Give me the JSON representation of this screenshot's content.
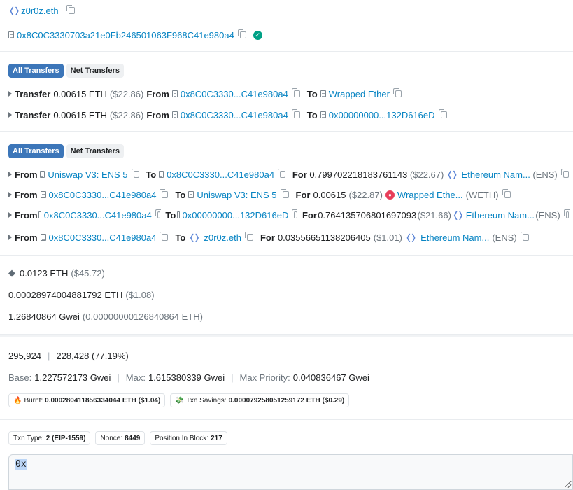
{
  "header": {
    "ens_name": "z0r0z.eth",
    "address": "0x8C0C3330703a21e0Fb246501063F968C41e980a4"
  },
  "tabs1": {
    "all": "All Transfers",
    "net": "Net Transfers"
  },
  "transfers": [
    {
      "kw": "Transfer",
      "amount": "0.00615 ETH",
      "usd": "($22.86)",
      "from_kw": "From",
      "from": "0x8C0C3330...C41e980a4",
      "to_kw": "To",
      "to": "Wrapped Ether"
    },
    {
      "kw": "Transfer",
      "amount": "0.00615 ETH",
      "usd": "($22.86)",
      "from_kw": "From",
      "from": "0x8C0C3330...C41e980a4",
      "to_kw": "To",
      "to": "0x00000000...132D616eD"
    }
  ],
  "tabs2": {
    "all": "All Transfers",
    "net": "Net Transfers"
  },
  "token_transfers": [
    {
      "from_kw": "From",
      "from": "Uniswap V3: ENS 5",
      "to_kw": "To",
      "to": "0x8C0C3330...C41e980a4",
      "for_kw": "For",
      "amount": "0.799702218183761143",
      "usd": "($22.67)",
      "token": "Ethereum Nam...",
      "symbol": "(ENS)"
    },
    {
      "from_kw": "From",
      "from": "0x8C0C3330...C41e980a4",
      "to_kw": "To",
      "to": "Uniswap V3: ENS 5",
      "for_kw": "For",
      "amount": "0.00615",
      "usd": "($22.87)",
      "token": "Wrapped Ethe...",
      "symbol": "(WETH)"
    },
    {
      "from_kw": "From",
      "from": "0x8C0C3330...C41e980a4",
      "to_kw": "To",
      "to": "0x00000000...132D616eD",
      "for_kw": "For",
      "amount": "0.764135706801697093",
      "usd": "($21.66)",
      "token": "Ethereum Nam...",
      "symbol": "(ENS)"
    },
    {
      "from_kw": "From",
      "from": "0x8C0C3330...C41e980a4",
      "to_kw": "To",
      "to": "z0r0z.eth",
      "for_kw": "For",
      "amount": "0.03556651138206405",
      "usd": "($1.01)",
      "token": "Ethereum Nam...",
      "symbol": "(ENS)"
    }
  ],
  "value": {
    "eth": "0.0123 ETH",
    "usd": "($45.72)"
  },
  "fee": {
    "eth": "0.00028974004881792 ETH",
    "usd": "($1.08)"
  },
  "gas_price": {
    "gwei": "1.26840864 Gwei",
    "eth": "(0.00000000126840864 ETH)"
  },
  "gas": {
    "limit": "295,924",
    "used": "228,428 (77.19%)"
  },
  "fees": {
    "base_label": "Base:",
    "base": "1.227572173 Gwei",
    "max_label": "Max:",
    "max": "1.615380339 Gwei",
    "priority_label": "Max Priority:",
    "priority": "0.040836467 Gwei"
  },
  "burnt": {
    "label": "Burnt:",
    "value": "0.000280411856334044 ETH ($1.04)"
  },
  "savings": {
    "label": "Txn Savings:",
    "value": "0.000079258051259172 ETH ($0.29)"
  },
  "other": {
    "type_label": "Txn Type:",
    "type": "2 (EIP-1559)",
    "nonce_label": "Nonce:",
    "nonce": "8449",
    "position_label": "Position In Block:",
    "position": "217"
  },
  "input_data": {
    "value": "0x"
  },
  "colors": {
    "link": "#0784c3",
    "tab_active": "#3c76b9",
    "success": "#00a186"
  }
}
